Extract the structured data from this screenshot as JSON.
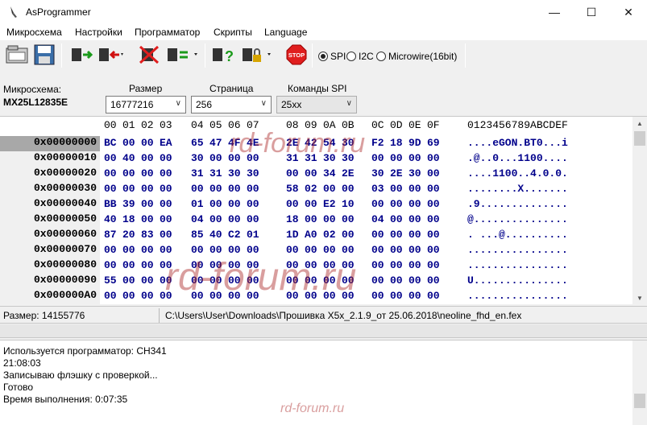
{
  "window": {
    "title": "AsProgrammer",
    "minimize_glyph": "—",
    "maximize_glyph": "☐",
    "close_glyph": "✕"
  },
  "menu": [
    "Микросхема",
    "Настройки",
    "Программатор",
    "Скрипты",
    "Language"
  ],
  "toolbar": {
    "interface_options": [
      {
        "label": "SPI",
        "selected": true
      },
      {
        "label": "I2C",
        "selected": false
      },
      {
        "label": "Microwire(16bit)",
        "selected": false
      }
    ],
    "stop_label": "STOP",
    "icons": [
      "open-file-icon",
      "save-file-icon",
      "read-chip-icon",
      "write-chip-icon",
      "erase-chip-icon",
      "verify-chip-icon",
      "chip-info-icon",
      "protect-chip-icon",
      "stop-icon"
    ]
  },
  "params": {
    "chip_label": "Микросхема:",
    "chip_value": "MX25L12835E",
    "size_label": "Размер",
    "size_value": "16777216",
    "page_label": "Страница",
    "page_value": "256",
    "spi_cmd_label": "Команды SPI",
    "spi_cmd_value": "25xx"
  },
  "hex": {
    "columns": [
      "00",
      "01",
      "02",
      "03",
      "04",
      "05",
      "06",
      "07",
      "08",
      "09",
      "0A",
      "0B",
      "0C",
      "0D",
      "0E",
      "0F"
    ],
    "ascii_header": "0123456789ABCDEF",
    "rows": [
      {
        "addr": "0x00000000",
        "bytes": [
          "BC",
          "00",
          "00",
          "EA",
          "65",
          "47",
          "4F",
          "4E",
          "2E",
          "42",
          "54",
          "30",
          "F2",
          "18",
          "9D",
          "69"
        ],
        "ascii": "....eGON.BT0...i"
      },
      {
        "addr": "0x00000010",
        "bytes": [
          "00",
          "40",
          "00",
          "00",
          "30",
          "00",
          "00",
          "00",
          "31",
          "31",
          "30",
          "30",
          "00",
          "00",
          "00",
          "00"
        ],
        "ascii": ".@..0...1100...."
      },
      {
        "addr": "0x00000020",
        "bytes": [
          "00",
          "00",
          "00",
          "00",
          "31",
          "31",
          "30",
          "30",
          "00",
          "00",
          "34",
          "2E",
          "30",
          "2E",
          "30",
          "00"
        ],
        "ascii": "....1100..4.0.0."
      },
      {
        "addr": "0x00000030",
        "bytes": [
          "00",
          "00",
          "00",
          "00",
          "00",
          "00",
          "00",
          "00",
          "58",
          "02",
          "00",
          "00",
          "03",
          "00",
          "00",
          "00"
        ],
        "ascii": "........X......."
      },
      {
        "addr": "0x00000040",
        "bytes": [
          "BB",
          "39",
          "00",
          "00",
          "01",
          "00",
          "00",
          "00",
          "00",
          "00",
          "E2",
          "10",
          "00",
          "00",
          "00",
          "00"
        ],
        "ascii": ".9.............."
      },
      {
        "addr": "0x00000050",
        "bytes": [
          "40",
          "18",
          "00",
          "00",
          "04",
          "00",
          "00",
          "00",
          "18",
          "00",
          "00",
          "00",
          "04",
          "00",
          "00",
          "00"
        ],
        "ascii": "@..............."
      },
      {
        "addr": "0x00000060",
        "bytes": [
          "87",
          "20",
          "83",
          "00",
          "85",
          "40",
          "C2",
          "01",
          "1D",
          "A0",
          "02",
          "00",
          "00",
          "00",
          "00",
          "00"
        ],
        "ascii": ". ...@.........."
      },
      {
        "addr": "0x00000070",
        "bytes": [
          "00",
          "00",
          "00",
          "00",
          "00",
          "00",
          "00",
          "00",
          "00",
          "00",
          "00",
          "00",
          "00",
          "00",
          "00",
          "00"
        ],
        "ascii": "................"
      },
      {
        "addr": "0x00000080",
        "bytes": [
          "00",
          "00",
          "00",
          "00",
          "00",
          "00",
          "00",
          "00",
          "00",
          "00",
          "00",
          "00",
          "00",
          "00",
          "00",
          "00"
        ],
        "ascii": "................"
      },
      {
        "addr": "0x00000090",
        "bytes": [
          "55",
          "00",
          "00",
          "00",
          "00",
          "00",
          "00",
          "00",
          "00",
          "00",
          "00",
          "00",
          "00",
          "00",
          "00",
          "00"
        ],
        "ascii": "U..............."
      },
      {
        "addr": "0x000000A0",
        "bytes": [
          "00",
          "00",
          "00",
          "00",
          "00",
          "00",
          "00",
          "00",
          "00",
          "00",
          "00",
          "00",
          "00",
          "00",
          "00",
          "00"
        ],
        "ascii": "................"
      }
    ]
  },
  "status": {
    "size_text": "Размер: 14155776",
    "file_path": "C:\\Users\\User\\Downloads\\Прошивка X5x_2.1.9_от 25.06.2018\\neoline_fhd_en.fex"
  },
  "log": [
    "Используется программатор: CH341",
    "21:08:03",
    "Записываю флэшку с проверкой...",
    "Готово",
    "Время выполнения: 0:07:35"
  ],
  "watermark": "rd-forum.ru",
  "colors": {
    "hex_text": "#00008b",
    "accent_stop": "#e01e1e",
    "selected_addr_bg": "#a8a8a8"
  }
}
